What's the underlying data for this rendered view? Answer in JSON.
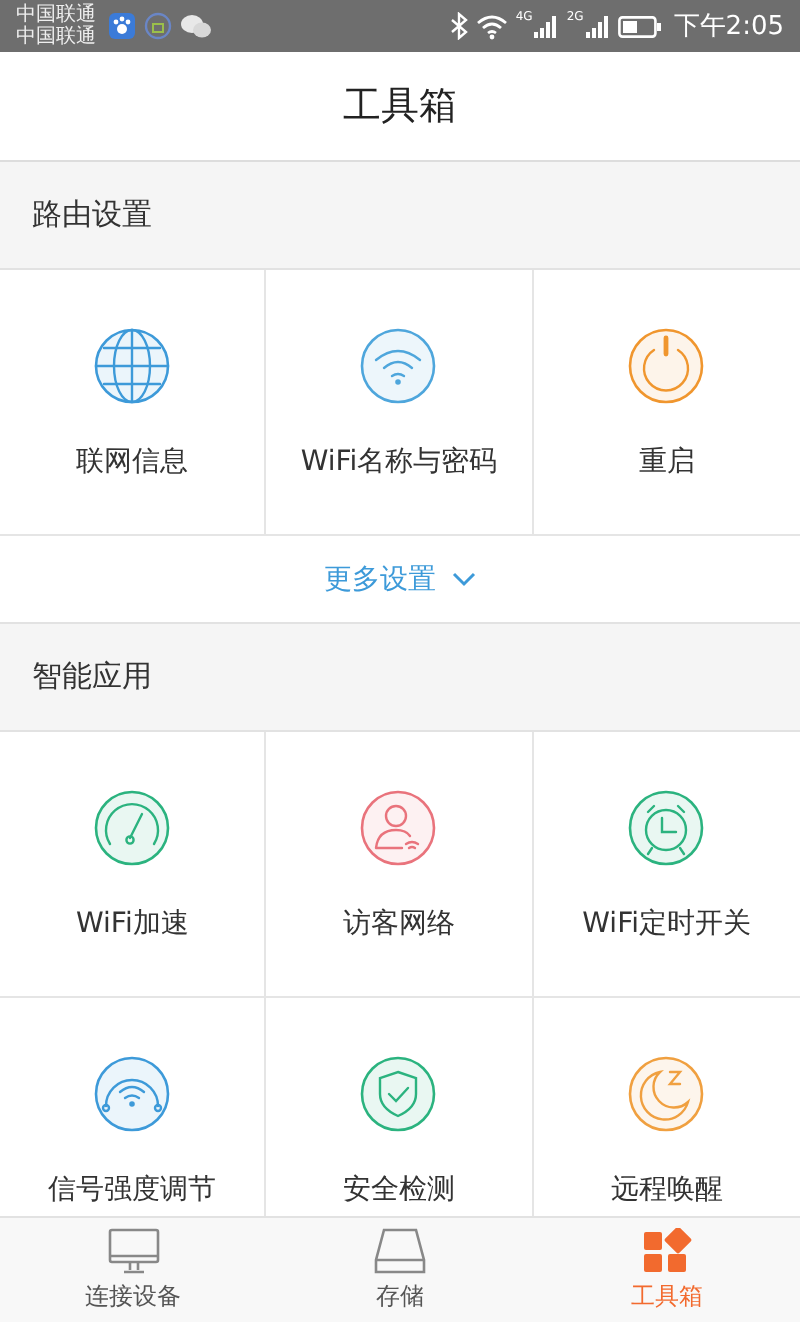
{
  "status_bar": {
    "carriers": [
      "中国联通",
      "中国联通"
    ],
    "network_4g": "4G",
    "network_2g": "2G",
    "time": "下午2:05"
  },
  "header": {
    "title": "工具箱"
  },
  "sections": [
    {
      "title": "路由设置",
      "items": [
        {
          "kind": "globe",
          "label": "联网信息",
          "color": "#3d9ad9"
        },
        {
          "kind": "wifi",
          "label": "WiFi名称与密码",
          "color": "#4ea6dc"
        },
        {
          "kind": "power",
          "label": "重启",
          "color": "#f0962e"
        }
      ],
      "more": {
        "label": "更多设置"
      }
    },
    {
      "title": "智能应用",
      "items": [
        {
          "kind": "speed",
          "label": "WiFi加速",
          "color": "#2bb37f"
        },
        {
          "kind": "guest",
          "label": "访客网络",
          "color": "#e9737c"
        },
        {
          "kind": "alarm",
          "label": "WiFi定时开关",
          "color": "#2bb37f"
        },
        {
          "kind": "signal",
          "label": "信号强度调节",
          "color": "#3d9ad9"
        },
        {
          "kind": "shield",
          "label": "安全检测",
          "color": "#2bb37f"
        },
        {
          "kind": "moon",
          "label": "远程唤醒",
          "color": "#f0a040"
        }
      ]
    }
  ],
  "tabs": [
    {
      "kind": "monitor",
      "label": "连接设备",
      "selected": false
    },
    {
      "kind": "disk",
      "label": "存储",
      "selected": false
    },
    {
      "kind": "tools",
      "label": "工具箱",
      "selected": true
    }
  ]
}
